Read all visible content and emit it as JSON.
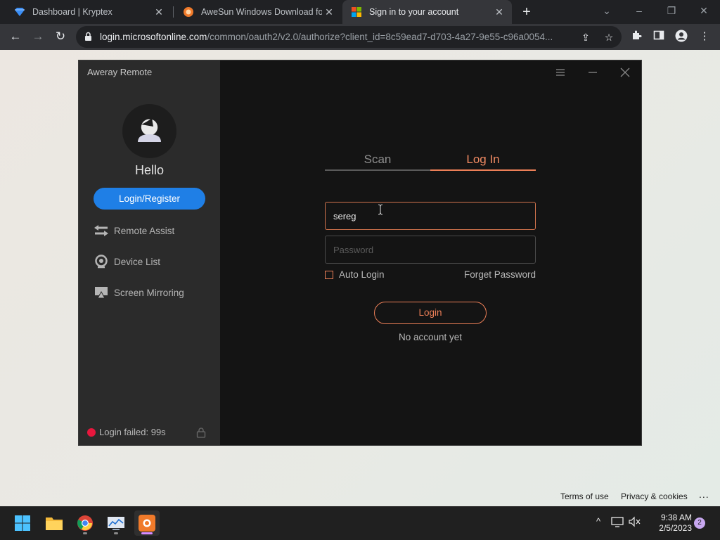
{
  "browser": {
    "tabs": [
      {
        "title": "Dashboard | Kryptex",
        "icon": "kryptex-diamond-icon",
        "active": false
      },
      {
        "title": "AweSun Windows Download for",
        "icon": "awesun-sun-icon",
        "active": false
      },
      {
        "title": "Sign in to your account",
        "icon": "microsoft-logo-icon",
        "active": true
      }
    ],
    "new_tab": "+",
    "url_host": "login.microsoftonline.com",
    "url_path": "/common/oauth2/v2.0/authorize?client_id=8c59ead7-d703-4a27-9e55-c96a0054...",
    "colors": {
      "tabstrip": "#202124",
      "toolbar": "#35363a",
      "omnibox": "#202124"
    }
  },
  "page": {
    "footer": {
      "terms": "Terms of use",
      "privacy": "Privacy & cookies",
      "more": "..."
    }
  },
  "app": {
    "title": "Aweray Remote",
    "hello": "Hello",
    "login_register": "Login/Register",
    "menu": [
      {
        "label": "Remote Assist",
        "icon": "remote-assist-arrows-icon"
      },
      {
        "label": "Device List",
        "icon": "device-list-icon"
      },
      {
        "label": "Screen Mirroring",
        "icon": "screen-mirroring-icon"
      }
    ],
    "status": "Login failed: 99s",
    "tabs": {
      "scan": "Scan",
      "login": "Log In"
    },
    "username_value": "sereg",
    "password_placeholder": "Password",
    "auto_login": "Auto Login",
    "forget_password": "Forget Password",
    "login_button": "Login",
    "no_account": "No account yet",
    "colors": {
      "accent": "#ec7f57",
      "primary_blue": "#1f7fe6",
      "error_red": "#e8173d",
      "sidebar": "#2b2b2b",
      "content": "#141414"
    }
  },
  "taskbar": {
    "apps": [
      "windows-start-icon",
      "file-explorer-icon",
      "chrome-icon",
      "monitor-app-icon",
      "awesun-app-icon"
    ],
    "time": "9:38 AM",
    "date": "2/5/2023",
    "notifications": "2"
  }
}
